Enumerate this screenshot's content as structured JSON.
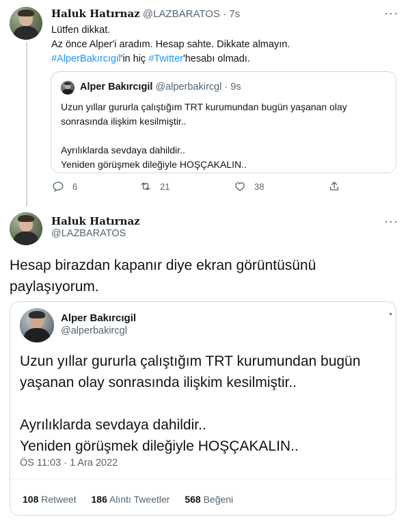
{
  "tweet1": {
    "author_name": "Haluk Hatırnaz",
    "author_handle": "@LAZBARATOS",
    "separator": "·",
    "time": "7s",
    "text_line1": "Lütfen dikkat.",
    "text_line2": "Az önce Alper'i aradım. Hesap sahte. Dikkate almayın.",
    "hashtag1": "#AlperBakırcıgil",
    "mid_text": "'in hiç ",
    "hashtag2": "#Twitter",
    "end_text": "'hesabı olmadı.",
    "quote": {
      "author_name": "Alper Bakırcıgil",
      "author_handle": "@alperbakircgl",
      "separator": "·",
      "time": "9s",
      "line1": "Uzun yıllar gururla çalıştığım TRT kurumundan bugün yaşanan olay",
      "line2": "sonrasında ilişkim kesilmiştir..",
      "line3": "Ayrılıklarda sevdaya dahildir..",
      "line4": "Yeniden görüşmek dileğiyle HOŞÇAKALIN.."
    },
    "actions": {
      "reply_count": "6",
      "retweet_count": "21",
      "like_count": "38"
    }
  },
  "tweet2": {
    "author_name": "Haluk Hatırnaz",
    "author_handle": "@LAZBARATOS",
    "text_line1": "Hesap birazdan kapanır diye ekran görüntüsünü",
    "text_line2": "paylaşıyorum.",
    "embedded": {
      "author_name": "Alper Bakırcıgil",
      "author_handle": "@alperbakircgl",
      "line1": "Uzun yıllar gururla çalıştığım TRT kurumundan bugün",
      "line2": "yaşanan olay sonrasında ilişkim kesilmiştir..",
      "line3": "Ayrılıklarda sevdaya dahildir..",
      "line4": "Yeniden görüşmek dileğiyle HOŞÇAKALIN..",
      "timestamp": "ÖS 11:03 · 1 Ara 2022",
      "retweet_count": "108",
      "retweet_label": "Retweet",
      "quote_count": "186",
      "quote_label": "Alıntı Tweetler",
      "like_count": "568",
      "like_label": "Beğeni"
    }
  },
  "colors": {
    "hashtag": "#1d9bf0",
    "muted": "#536471",
    "border": "#cfd9de"
  },
  "icons": [
    "more-icon",
    "reply-icon",
    "retweet-icon",
    "like-icon",
    "share-icon"
  ]
}
